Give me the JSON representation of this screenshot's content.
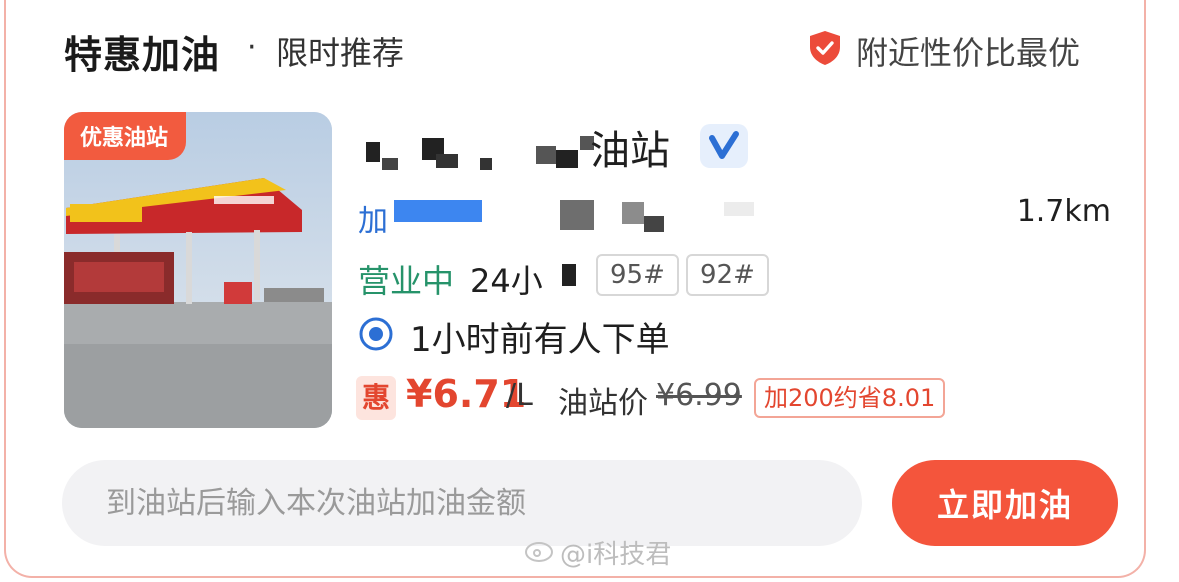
{
  "header": {
    "title": "特惠加油",
    "dot": "·",
    "subtitle": "限时推荐",
    "right_label": "附近性价比最优",
    "shield_icon": "shield-check-icon"
  },
  "station": {
    "photo_tag": "优惠油站",
    "name_suffix": "油站",
    "address_prefix": "加",
    "distance": "1.7km",
    "status_open": "营业中",
    "status_hours": "24小",
    "fuel_types": [
      "95#",
      "92#"
    ],
    "order_text": "1小时前有人下单",
    "discount_badge": "惠",
    "price": "¥6.71",
    "price_unit": "/L",
    "orig_label": "油站价",
    "orig_price": "¥6.99",
    "promo": "加200约省8.01"
  },
  "actions": {
    "amount_placeholder": "到油站后输入本次油站加油金额",
    "fuel_button": "立即加油"
  },
  "watermark": "@i科技君",
  "colors": {
    "accent": "#f4553c",
    "price": "#e3462f",
    "open": "#26936a",
    "address": "#2c6fd4"
  }
}
